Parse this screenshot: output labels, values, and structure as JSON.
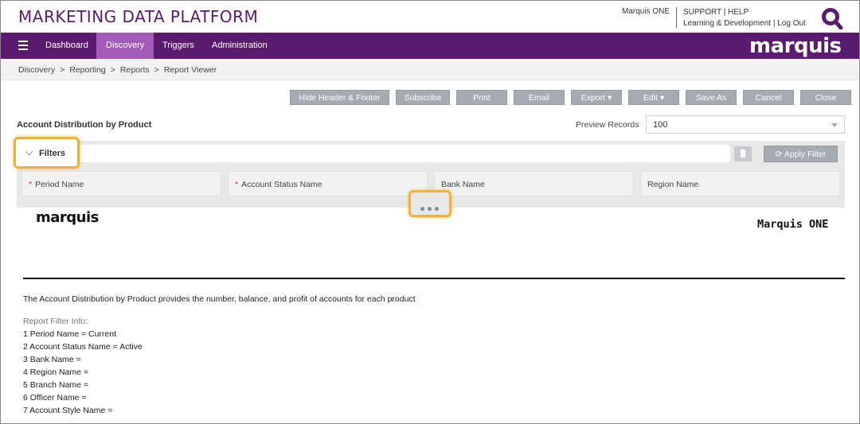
{
  "header": {
    "app_title": "MARKETING DATA PLATFORM",
    "user_name": "Marquis ONE",
    "support": "SUPPORT",
    "help": "HELP",
    "learning": "Learning & Development",
    "logout": "Log Out",
    "link_sep": "|"
  },
  "nav": {
    "items": [
      {
        "label": "Dashboard"
      },
      {
        "label": "Discovery"
      },
      {
        "label": "Triggers"
      },
      {
        "label": "Administration"
      }
    ],
    "logo": "marquis"
  },
  "breadcrumb": {
    "items": [
      "Discovery",
      "Reporting",
      "Reports",
      "Report Viewer"
    ],
    "separator": ">"
  },
  "toolbar": {
    "hide_header_footer": "Hide Header & Footer",
    "subscribe": "Subscribe",
    "print": "Print",
    "email": "Email",
    "export": "Export ▾",
    "edit": "Edit ▾",
    "save_as": "Save As",
    "cancel": "Cancel",
    "close": "Close"
  },
  "report": {
    "title": "Account Distribution by Product",
    "preview_label": "Preview Records",
    "preview_value": "100",
    "logo": "marquis",
    "brand": "Marquis ONE",
    "description": "The Account Distribution by Product provides the number, balance, and profit of accounts for each product",
    "filter_info_title": "Report Filter Info:",
    "filter_lines": [
      "1 Period Name = Current",
      "2 Account Status Name = Active",
      "3 Bank Name =",
      "4 Region Name =",
      "5 Branch Name =",
      "6 Officer Name =",
      "7 Account Style Name ="
    ]
  },
  "filters": {
    "label": "Filters",
    "apply_label": "Apply Filter",
    "required_mark": "*",
    "fields": [
      {
        "label": "Period Name",
        "required": true
      },
      {
        "label": "Account Status Name",
        "required": true
      },
      {
        "label": "Bank Name",
        "required": false
      },
      {
        "label": "Region Name",
        "required": false
      }
    ]
  },
  "colors": {
    "brand_purple": "#5a1a6e",
    "nav_active": "#a25bb8",
    "highlight": "#f0b040",
    "button_gray": "#a4abb3"
  }
}
